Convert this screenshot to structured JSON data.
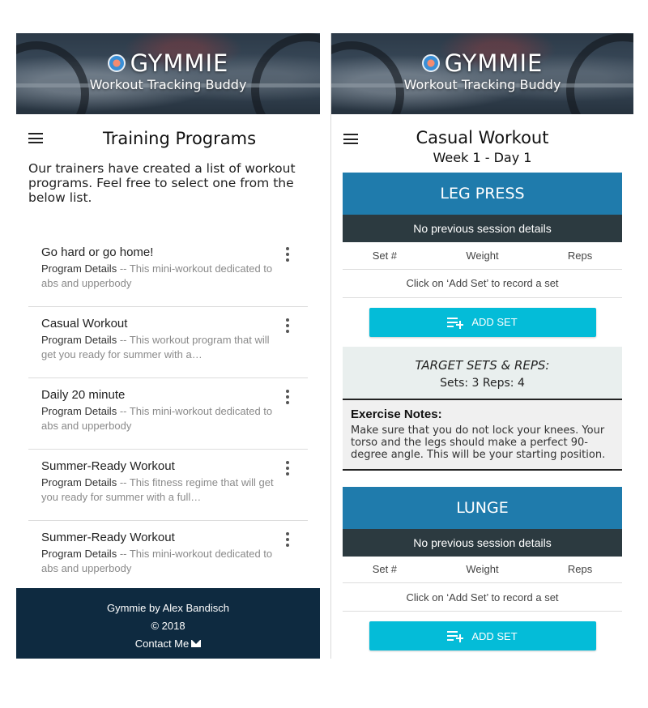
{
  "brand": {
    "name": "GYMMIE",
    "tagline": "Workout Tracking Buddy"
  },
  "left": {
    "title": "Training Programs",
    "intro": "Our trainers have created a list of workout programs. Feel free to select one from the below list.",
    "programs": [
      {
        "name": "Go hard or go home!",
        "lead": "Program Details",
        "desc": " -- This mini-workout dedicated to abs and upperbody"
      },
      {
        "name": "Casual Workout",
        "lead": "Program Details",
        "desc": " -- This workout program that will get you ready for summer with a…"
      },
      {
        "name": "Daily 20 minute",
        "lead": "Program Details",
        "desc": " -- This mini-workout dedicated to abs and upperbody"
      },
      {
        "name": "Summer-Ready Workout",
        "lead": "Program Details",
        "desc": " -- This fitness regime that will get you ready for summer with a full…"
      },
      {
        "name": "Summer-Ready Workout",
        "lead": "Program Details",
        "desc": " -- This mini-workout dedicated to abs and upperbody"
      }
    ],
    "footer": {
      "credit": "Gymmie by Alex Bandisch",
      "copyright": "© 2018",
      "contact": "Contact Me"
    }
  },
  "right": {
    "title": "Casual Workout",
    "week_day": "Week 1 - Day 1",
    "exercises": [
      {
        "name": "LEG PRESS",
        "previous": "No previous session details",
        "columns": [
          "Set #",
          "Weight",
          "Reps"
        ],
        "empty_hint": "Click on ‘Add Set’ to record a set",
        "add_label": "ADD SET",
        "target_label": "TARGET SETS & REPS:",
        "target_value": "Sets: 3 Reps: 4",
        "notes_label": "Exercise Notes:",
        "notes": "Make sure that you do not lock your knees. Your torso and the legs should make a perfect 90-degree angle. This will be your starting position."
      },
      {
        "name": "LUNGE",
        "previous": "No previous session details",
        "columns": [
          "Set #",
          "Weight",
          "Reps"
        ],
        "empty_hint": "Click on ‘Add Set’ to record a set",
        "add_label": "ADD SET"
      }
    ]
  },
  "colors": {
    "exercise_header": "#1f7bac",
    "previous_bar": "#2c3a40",
    "add_button": "#04bcd8",
    "footer": "#0e2a40",
    "target_box": "#e9efee"
  },
  "icons": [
    "menu-icon",
    "more-vert-icon",
    "playlist-add-icon",
    "mail-icon",
    "gymmie-logo-icon"
  ]
}
